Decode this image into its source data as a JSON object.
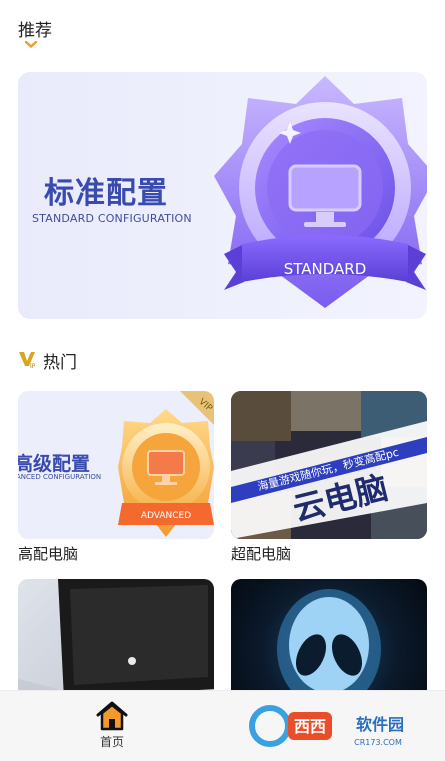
{
  "sections": {
    "recommend_title": "推荐",
    "hot_title": "热门"
  },
  "hero": {
    "title": "标准配置",
    "subtitle": "STANDARD CONFIGURATION",
    "badge_text": "STANDARD"
  },
  "cards": [
    {
      "label": "高配电脑",
      "title": "高级配置",
      "subtitle": "ANCED CONFIGURATION",
      "badge_text": "ADVANCED",
      "corner": "VIP"
    },
    {
      "label": "超配电脑",
      "banner_small": "海量游戏随你玩，秒变高配pc",
      "banner_big": "云电脑"
    },
    {
      "label": ""
    },
    {
      "label": ""
    }
  ],
  "tabbar": {
    "home_label": "首页"
  },
  "watermark": {
    "text": "西西软件园",
    "url": "CR173.COM"
  },
  "colors": {
    "accent_orange": "#f29a2e",
    "brand_blue": "#3a4bb0",
    "badge_purple": "#7b5cf0"
  }
}
